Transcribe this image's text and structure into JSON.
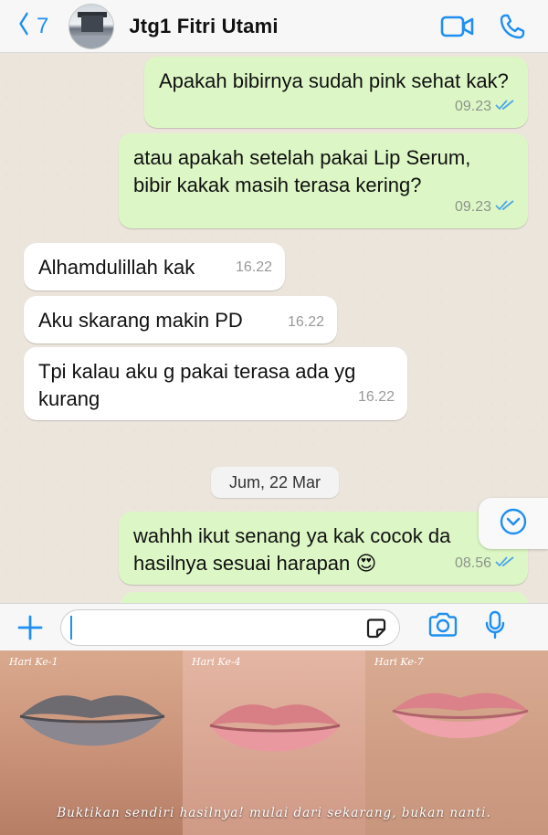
{
  "header": {
    "back_count": "7",
    "contact_name": "Jtg1 Fitri Utami"
  },
  "messages": [
    {
      "direction": "out",
      "text": "Apakah bibirnya sudah pink sehat kak?",
      "time": "09.23"
    },
    {
      "direction": "out",
      "text": "atau apakah setelah pakai Lip Serum, bibir kakak masih terasa kering?",
      "time": "09.23"
    },
    {
      "direction": "in",
      "text": "Alhamdulillah kak",
      "time": "16.22"
    },
    {
      "direction": "in",
      "text": "Aku skarang makin PD",
      "time": "16.22"
    },
    {
      "direction": "in",
      "text": "Tpi kalau aku g pakai terasa ada yg kurang",
      "time": "16.22"
    },
    {
      "direction": "out",
      "text": "wahhh ikut senang ya kak cocok da hasilnya sesuai harapan 😍",
      "time": "08.56"
    }
  ],
  "date_separator": "Jum, 22 Mar",
  "composer": {
    "placeholder": ""
  },
  "photos": [
    {
      "label": "Hari Ke-1"
    },
    {
      "label": "Hari Ke-4"
    },
    {
      "label": "Hari Ke-7"
    }
  ],
  "caption": "Buktikan sendiri hasilnya! mulai dari sekarang, bukan nanti.",
  "colors": {
    "accent": "#1f8ff1",
    "outgoing_bubble": "#dcf7c5",
    "incoming_bubble": "#ffffff",
    "chat_background": "#ece5dc",
    "read_ticks": "#4fa6e6"
  },
  "icons": [
    "back-chevron-icon",
    "video-call-icon",
    "phone-icon",
    "scroll-down-icon",
    "plus-icon",
    "sticker-icon",
    "camera-icon",
    "microphone-icon"
  ]
}
